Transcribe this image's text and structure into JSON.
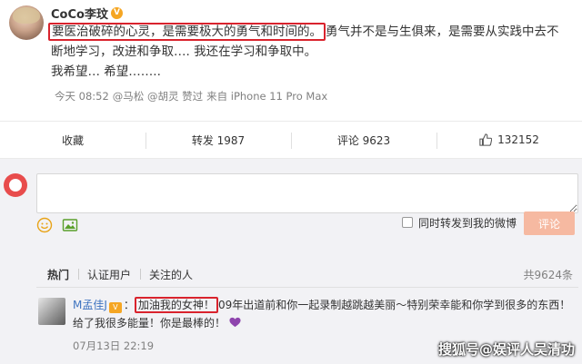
{
  "post": {
    "user_name": "CoCo李玟",
    "verify_badge": "V",
    "highlight_text": "要医治破碎的心灵，是需要极大的勇气和时间的。",
    "text_line1_rest": "勇气并不是与生俱来，是需要从实践中去不",
    "text_line2": "断地学习，改进和争取…. 我还在学习和争取中。",
    "text_line3": "我希望… 希望……..",
    "time": "今天 08:52",
    "liked_by": "@马松 @胡灵 赞过",
    "source": "来自 iPhone 11 Pro Max"
  },
  "actions": {
    "collect": "收藏",
    "repost": "转发 1987",
    "comment": "评论 9623",
    "like": "132152"
  },
  "composer": {
    "placeholder": "",
    "repost_label": "同时转发到我的微博",
    "submit": "评论"
  },
  "tabs": {
    "hot": "热门",
    "verified": "认证用户",
    "following": "关注的人",
    "count": "共9624条"
  },
  "comment": {
    "user": "M孟佳J",
    "vip": "V",
    "sep": "：",
    "highlight": "加油我的女神！",
    "text": "09年出道前和你一起录制越跳越美丽～特别荣幸能和你学到很多的东西！给了我很多能量！你是最棒的！",
    "time": "07月13日 22:19"
  },
  "watermark": "搜狐号@娱评人吴清功",
  "colors": {
    "highlight_border": "#d9232d",
    "link_blue": "#3f74c0",
    "submit_btn": "#f6b9a1",
    "composer_bg": "#f2f2f5"
  }
}
